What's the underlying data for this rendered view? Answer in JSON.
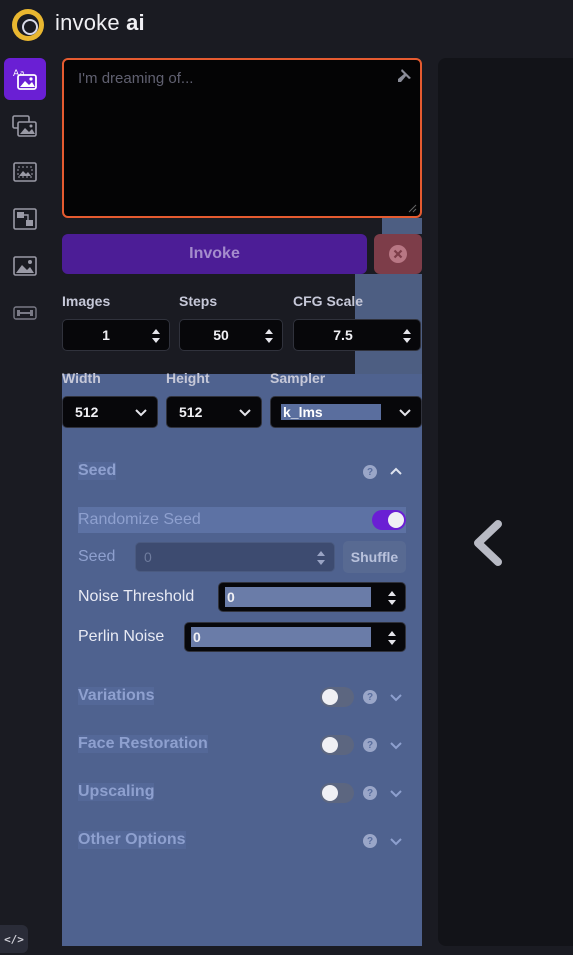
{
  "app": {
    "title_regular": "invoke",
    "title_bold": "ai"
  },
  "tabs": [
    {
      "name": "text-to-image",
      "icon": "text-image-icon",
      "active": true
    },
    {
      "name": "image-to-image",
      "icon": "image-stack-icon",
      "active": false
    },
    {
      "name": "inpainting",
      "icon": "inpaint-icon",
      "active": false
    },
    {
      "name": "nodes",
      "icon": "nodes-icon",
      "active": false
    },
    {
      "name": "outpainting",
      "icon": "outpaint-icon",
      "active": false
    },
    {
      "name": "training",
      "icon": "dumbbell-icon",
      "active": false
    }
  ],
  "prompt": {
    "placeholder": "I'm dreaming of...",
    "value": ""
  },
  "invoke": {
    "label": "Invoke"
  },
  "params": {
    "images": {
      "label": "Images",
      "value": "1"
    },
    "steps": {
      "label": "Steps",
      "value": "50"
    },
    "cfg": {
      "label": "CFG Scale",
      "value": "7.5"
    },
    "width": {
      "label": "Width",
      "value": "512"
    },
    "height": {
      "label": "Height",
      "value": "512"
    },
    "sampler": {
      "label": "Sampler",
      "value": "k_lms"
    }
  },
  "seed_section": {
    "title": "Seed",
    "randomize_label": "Randomize Seed",
    "randomize_on": true,
    "seed_label": "Seed",
    "seed_value": "0",
    "shuffle_label": "Shuffle",
    "noise_label": "Noise Threshold",
    "noise_value": "0",
    "perlin_label": "Perlin Noise",
    "perlin_value": "0"
  },
  "sections": [
    {
      "title": "Variations",
      "enabled": false
    },
    {
      "title": "Face Restoration",
      "enabled": false
    },
    {
      "title": "Upscaling",
      "enabled": false
    },
    {
      "title": "Other Options"
    }
  ],
  "dev_button": {
    "label": "</>"
  },
  "colors": {
    "accent": "#6a1fd4",
    "prompt_border": "#e55b30",
    "logo": "#e9b730"
  }
}
